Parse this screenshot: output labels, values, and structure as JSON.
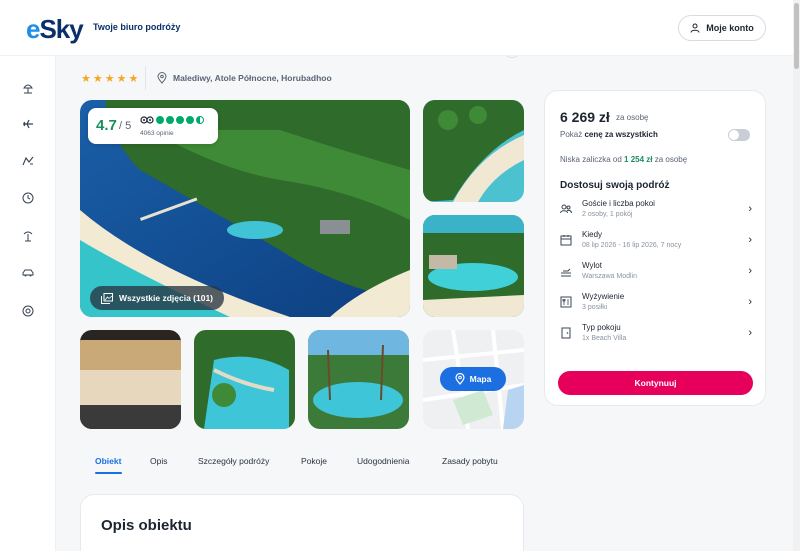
{
  "header": {
    "logo_prefix": "e",
    "logo_rest": "Sky",
    "tagline": "Twoje biuro podróży",
    "account_label": "Moje konto"
  },
  "hotel": {
    "stars": "★★★★★",
    "location": "Malediwy, Atole Północne, Horubadhoo"
  },
  "rating": {
    "score": "4.7",
    "scale": "/ 5",
    "reviews": "4063 opinie",
    "dots_full": 4,
    "dots_half": 1
  },
  "gallery": {
    "all_photos_label": "Wszystkie zdjęcia (101)",
    "map_label": "Mapa"
  },
  "tabs": [
    {
      "label": "Obiekt"
    },
    {
      "label": "Opis"
    },
    {
      "label": "Szczegóły podróży"
    },
    {
      "label": "Pokoje"
    },
    {
      "label": "Udogodnienia"
    },
    {
      "label": "Zasady pobytu"
    }
  ],
  "description": {
    "title": "Opis obiektu"
  },
  "booking": {
    "price": "6 269 zł",
    "per_person": "za osobę",
    "show_total_prefix": "Pokaż ",
    "show_total_bold": "cenę za wszystkich",
    "deposit_prefix": "Niska zaliczka od ",
    "deposit_amount": "1 254 zł",
    "deposit_suffix": " za osobę",
    "customize_title": "Dostosuj swoją podróż",
    "options": [
      {
        "label": "Goście i liczba pokoi",
        "sub": "2 osoby, 1 pokój"
      },
      {
        "label": "Kiedy",
        "sub": "08 lip 2026 - 16 lip 2026, 7 nocy"
      },
      {
        "label": "Wylot",
        "sub": "Warszawa Modlin"
      },
      {
        "label": "Wyżywienie",
        "sub": "3 posiłki"
      },
      {
        "label": "Typ pokoju",
        "sub": "1x Beach Villa"
      }
    ],
    "cta_label": "Kontynuuj"
  },
  "colors": {
    "accent_blue": "#1b6fe0",
    "cta_pink": "#e6005c",
    "rating_green": "#1a8f5e",
    "star_orange": "#f6a623"
  }
}
